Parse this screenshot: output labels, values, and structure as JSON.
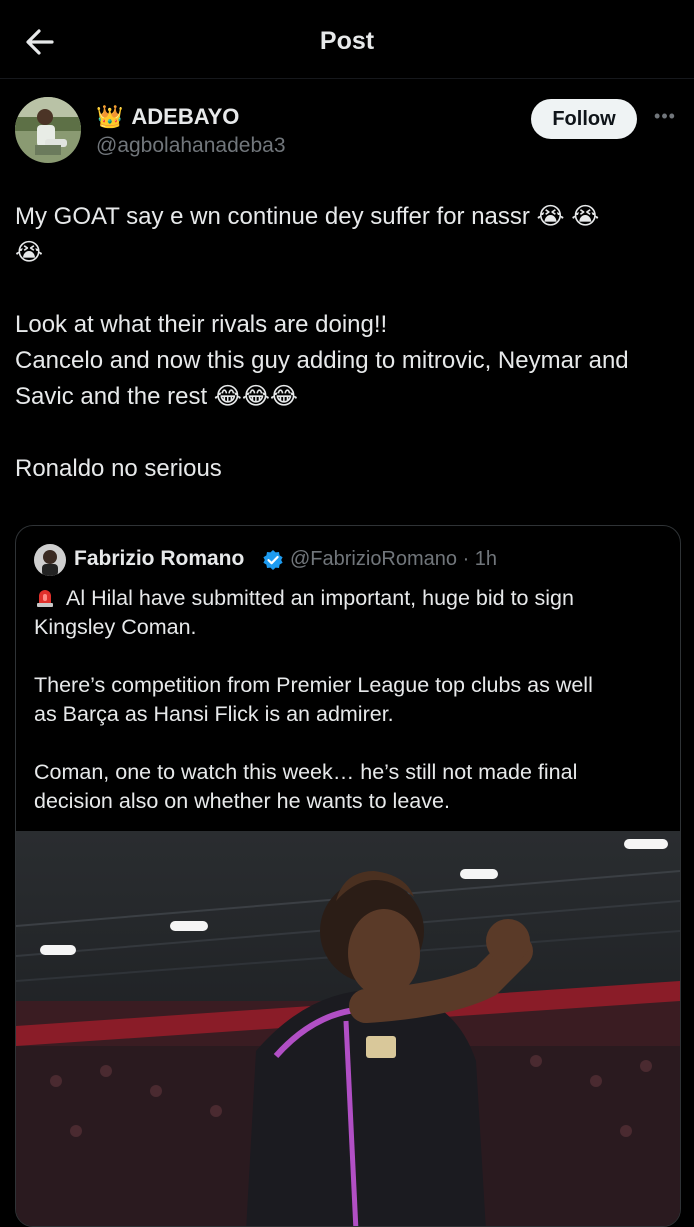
{
  "header": {
    "title": "Post"
  },
  "author": {
    "name": "ADEBAYO",
    "handle": "@agbolahanadeba3",
    "follow_label": "Follow",
    "more_label": "•••"
  },
  "post": {
    "lines": [
      "My GOAT say e wn continue dey suffer for nassr 😭 😭",
      "😭",
      "Look at what their rivals are doing!!",
      "Cancelo and now this guy adding to mitrovic, Neymar and",
      "Savic and the rest 😂😂😂",
      "Ronaldo no serious"
    ]
  },
  "quote": {
    "name": "Fabrizio Romano",
    "handle_time": "@FabrizioRomano · 1h",
    "lines": [
      "Al Hilal have submitted an important, huge bid to sign",
      "Kingsley Coman.",
      "There’s competition from Premier League top clubs as well",
      "as Barça as Hansi Flick is an admirer.",
      "Coman, one to watch this week… he’s still not made final",
      "decision also on whether he wants to leave."
    ]
  },
  "icons": {
    "back": "back-arrow-icon",
    "verified": "verified-badge-icon",
    "siren": "siren-icon"
  },
  "colors": {
    "background": "#000000",
    "text": "#e7e9ea",
    "secondary_text": "#71767b",
    "verified": "#1d9bf0",
    "follow_bg": "#eff3f4"
  }
}
